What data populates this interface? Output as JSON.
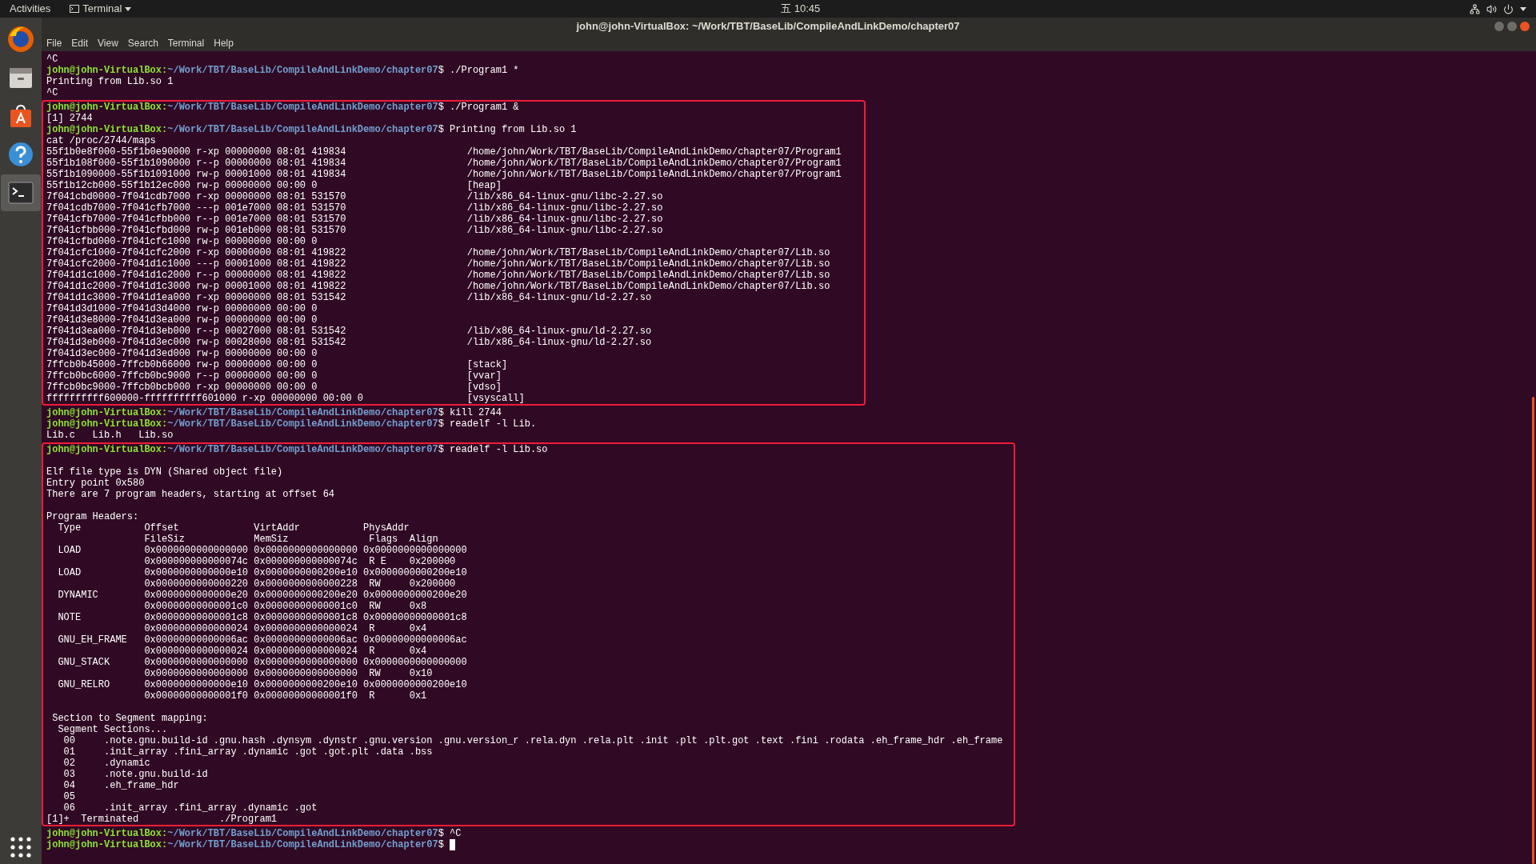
{
  "top_bar": {
    "activities": "Activities",
    "app_menu": "Terminal",
    "clock": "五 10:45"
  },
  "dock": {
    "items": [
      {
        "kind": "firefox",
        "selected": false
      },
      {
        "kind": "files",
        "selected": false
      },
      {
        "kind": "software",
        "selected": false
      },
      {
        "kind": "help",
        "selected": false
      },
      {
        "kind": "terminal",
        "selected": true
      }
    ]
  },
  "window": {
    "title": "john@john-VirtualBox: ~/Work/TBT/BaseLib/CompileAndLinkDemo/chapter07",
    "menu": [
      "File",
      "Edit",
      "View",
      "Search",
      "Terminal",
      "Help"
    ]
  },
  "terminal": {
    "segments": [
      {
        "highlighted": false,
        "lines": [
          {
            "kind": "output",
            "text": "^C"
          },
          {
            "kind": "prompt",
            "user": "john@john-VirtualBox:",
            "path": "~/Work/TBT/BaseLib/CompileAndLinkDemo/chapter07",
            "command": "$ ./Program1 *"
          },
          {
            "kind": "output",
            "text": "Printing from Lib.so 1"
          },
          {
            "kind": "output",
            "text": "^C"
          }
        ]
      },
      {
        "highlighted": true,
        "lines": [
          {
            "kind": "prompt",
            "user": "john@john-VirtualBox:",
            "path": "~/Work/TBT/BaseLib/CompileAndLinkDemo/chapter07",
            "command": "$ ./Program1 &"
          },
          {
            "kind": "output",
            "text": "[1] 2744"
          },
          {
            "kind": "prompt",
            "user": "john@john-VirtualBox:",
            "path": "~/Work/TBT/BaseLib/CompileAndLinkDemo/chapter07",
            "command": "$ Printing from Lib.so 1"
          },
          {
            "kind": "output",
            "text": "cat /proc/2744/maps"
          },
          {
            "kind": "output",
            "text": "55f1b0e8f000-55f1b0e90000 r-xp 00000000 08:01 419834                     /home/john/Work/TBT/BaseLib/CompileAndLinkDemo/chapter07/Program1"
          },
          {
            "kind": "output",
            "text": "55f1b108f000-55f1b1090000 r--p 00000000 08:01 419834                     /home/john/Work/TBT/BaseLib/CompileAndLinkDemo/chapter07/Program1"
          },
          {
            "kind": "output",
            "text": "55f1b1090000-55f1b1091000 rw-p 00001000 08:01 419834                     /home/john/Work/TBT/BaseLib/CompileAndLinkDemo/chapter07/Program1"
          },
          {
            "kind": "output",
            "text": "55f1b12cb000-55f1b12ec000 rw-p 00000000 00:00 0                          [heap]"
          },
          {
            "kind": "output",
            "text": "7f041cbd0000-7f041cdb7000 r-xp 00000000 08:01 531570                     /lib/x86_64-linux-gnu/libc-2.27.so"
          },
          {
            "kind": "output",
            "text": "7f041cdb7000-7f041cfb7000 ---p 001e7000 08:01 531570                     /lib/x86_64-linux-gnu/libc-2.27.so"
          },
          {
            "kind": "output",
            "text": "7f041cfb7000-7f041cfbb000 r--p 001e7000 08:01 531570                     /lib/x86_64-linux-gnu/libc-2.27.so"
          },
          {
            "kind": "output",
            "text": "7f041cfbb000-7f041cfbd000 rw-p 001eb000 08:01 531570                     /lib/x86_64-linux-gnu/libc-2.27.so"
          },
          {
            "kind": "output",
            "text": "7f041cfbd000-7f041cfc1000 rw-p 00000000 00:00 0"
          },
          {
            "kind": "output",
            "text": "7f041cfc1000-7f041cfc2000 r-xp 00000000 08:01 419822                     /home/john/Work/TBT/BaseLib/CompileAndLinkDemo/chapter07/Lib.so"
          },
          {
            "kind": "output",
            "text": "7f041cfc2000-7f041d1c1000 ---p 00001000 08:01 419822                     /home/john/Work/TBT/BaseLib/CompileAndLinkDemo/chapter07/Lib.so"
          },
          {
            "kind": "output",
            "text": "7f041d1c1000-7f041d1c2000 r--p 00000000 08:01 419822                     /home/john/Work/TBT/BaseLib/CompileAndLinkDemo/chapter07/Lib.so"
          },
          {
            "kind": "output",
            "text": "7f041d1c2000-7f041d1c3000 rw-p 00001000 08:01 419822                     /home/john/Work/TBT/BaseLib/CompileAndLinkDemo/chapter07/Lib.so"
          },
          {
            "kind": "output",
            "text": "7f041d1c3000-7f041d1ea000 r-xp 00000000 08:01 531542                     /lib/x86_64-linux-gnu/ld-2.27.so"
          },
          {
            "kind": "output",
            "text": "7f041d3d1000-7f041d3d4000 rw-p 00000000 00:00 0"
          },
          {
            "kind": "output",
            "text": "7f041d3e8000-7f041d3ea000 rw-p 00000000 00:00 0"
          },
          {
            "kind": "output",
            "text": "7f041d3ea000-7f041d3eb000 r--p 00027000 08:01 531542                     /lib/x86_64-linux-gnu/ld-2.27.so"
          },
          {
            "kind": "output",
            "text": "7f041d3eb000-7f041d3ec000 rw-p 00028000 08:01 531542                     /lib/x86_64-linux-gnu/ld-2.27.so"
          },
          {
            "kind": "output",
            "text": "7f041d3ec000-7f041d3ed000 rw-p 00000000 00:00 0"
          },
          {
            "kind": "output",
            "text": "7ffcb0b45000-7ffcb0b66000 rw-p 00000000 00:00 0                          [stack]"
          },
          {
            "kind": "output",
            "text": "7ffcb0bc6000-7ffcb0bc9000 r--p 00000000 00:00 0                          [vvar]"
          },
          {
            "kind": "output",
            "text": "7ffcb0bc9000-7ffcb0bcb000 r-xp 00000000 00:00 0                          [vdso]"
          },
          {
            "kind": "output",
            "text": "ffffffffff600000-ffffffffff601000 r-xp 00000000 00:00 0                  [vsyscall]"
          }
        ]
      },
      {
        "highlighted": false,
        "lines": [
          {
            "kind": "prompt",
            "user": "john@john-VirtualBox:",
            "path": "~/Work/TBT/BaseLib/CompileAndLinkDemo/chapter07",
            "command": "$ kill 2744"
          },
          {
            "kind": "prompt",
            "user": "john@john-VirtualBox:",
            "path": "~/Work/TBT/BaseLib/CompileAndLinkDemo/chapter07",
            "command": "$ readelf -l Lib."
          },
          {
            "kind": "output",
            "text": "Lib.c   Lib.h   Lib.so"
          }
        ]
      },
      {
        "highlighted": true,
        "lines": [
          {
            "kind": "prompt",
            "user": "john@john-VirtualBox:",
            "path": "~/Work/TBT/BaseLib/CompileAndLinkDemo/chapter07",
            "command": "$ readelf -l Lib.so"
          },
          {
            "kind": "blank"
          },
          {
            "kind": "output",
            "text": "Elf file type is DYN (Shared object file)"
          },
          {
            "kind": "output",
            "text": "Entry point 0x580"
          },
          {
            "kind": "output",
            "text": "There are 7 program headers, starting at offset 64"
          },
          {
            "kind": "blank"
          },
          {
            "kind": "output",
            "text": "Program Headers:"
          },
          {
            "kind": "output",
            "text": "  Type           Offset             VirtAddr           PhysAddr"
          },
          {
            "kind": "output",
            "text": "                 FileSiz            MemSiz              Flags  Align"
          },
          {
            "kind": "output",
            "text": "  LOAD           0x0000000000000000 0x0000000000000000 0x0000000000000000"
          },
          {
            "kind": "output",
            "text": "                 0x000000000000074c 0x000000000000074c  R E    0x200000"
          },
          {
            "kind": "output",
            "text": "  LOAD           0x0000000000000e10 0x0000000000200e10 0x0000000000200e10"
          },
          {
            "kind": "output",
            "text": "                 0x0000000000000220 0x0000000000000228  RW     0x200000"
          },
          {
            "kind": "output",
            "text": "  DYNAMIC        0x0000000000000e20 0x0000000000200e20 0x0000000000200e20"
          },
          {
            "kind": "output",
            "text": "                 0x00000000000001c0 0x00000000000001c0  RW     0x8"
          },
          {
            "kind": "output",
            "text": "  NOTE           0x00000000000001c8 0x00000000000001c8 0x00000000000001c8"
          },
          {
            "kind": "output",
            "text": "                 0x0000000000000024 0x0000000000000024  R      0x4"
          },
          {
            "kind": "output",
            "text": "  GNU_EH_FRAME   0x00000000000006ac 0x00000000000006ac 0x00000000000006ac"
          },
          {
            "kind": "output",
            "text": "                 0x0000000000000024 0x0000000000000024  R      0x4"
          },
          {
            "kind": "output",
            "text": "  GNU_STACK      0x0000000000000000 0x0000000000000000 0x0000000000000000"
          },
          {
            "kind": "output",
            "text": "                 0x0000000000000000 0x0000000000000000  RW     0x10"
          },
          {
            "kind": "output",
            "text": "  GNU_RELRO      0x0000000000000e10 0x0000000000200e10 0x0000000000200e10"
          },
          {
            "kind": "output",
            "text": "                 0x00000000000001f0 0x00000000000001f0  R      0x1"
          },
          {
            "kind": "blank"
          },
          {
            "kind": "output",
            "text": " Section to Segment mapping:"
          },
          {
            "kind": "output",
            "text": "  Segment Sections..."
          },
          {
            "kind": "output",
            "text": "   00     .note.gnu.build-id .gnu.hash .dynsym .dynstr .gnu.version .gnu.version_r .rela.dyn .rela.plt .init .plt .plt.got .text .fini .rodata .eh_frame_hdr .eh_frame"
          },
          {
            "kind": "output",
            "text": "   01     .init_array .fini_array .dynamic .got .got.plt .data .bss"
          },
          {
            "kind": "output",
            "text": "   02     .dynamic"
          },
          {
            "kind": "output",
            "text": "   03     .note.gnu.build-id"
          },
          {
            "kind": "output",
            "text": "   04     .eh_frame_hdr"
          },
          {
            "kind": "output",
            "text": "   05"
          },
          {
            "kind": "output",
            "text": "   06     .init_array .fini_array .dynamic .got"
          },
          {
            "kind": "output",
            "text": "[1]+  Terminated              ./Program1"
          }
        ]
      },
      {
        "highlighted": false,
        "lines": [
          {
            "kind": "prompt",
            "user": "john@john-VirtualBox:",
            "path": "~/Work/TBT/BaseLib/CompileAndLinkDemo/chapter07",
            "command": "$ ^C"
          },
          {
            "kind": "prompt",
            "user": "john@john-VirtualBox:",
            "path": "~/Work/TBT/BaseLib/CompileAndLinkDemo/chapter07",
            "command": "$",
            "cursor": true
          }
        ]
      }
    ]
  }
}
